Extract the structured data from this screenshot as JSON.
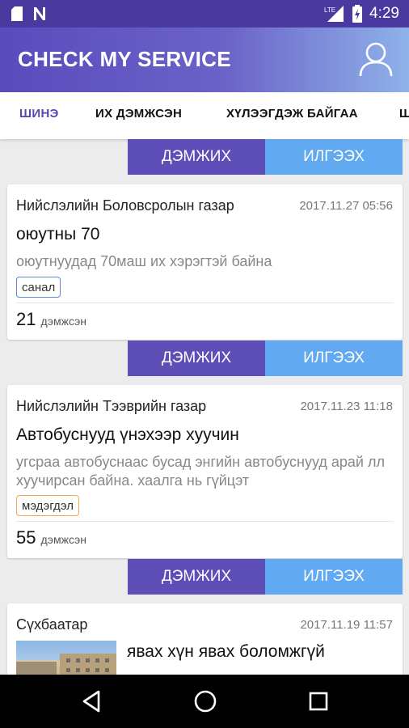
{
  "status_bar": {
    "time": "4:29",
    "network": "LTE"
  },
  "app": {
    "title": "CHECK MY SERVICE",
    "user_icon": "user-icon"
  },
  "tabs": [
    {
      "label": "ШИНЭ",
      "active": true
    },
    {
      "label": "ИХ ДЭМЖСЭН",
      "active": false
    },
    {
      "label": "ХҮЛЭЭГДЭЖ БАЙГАА",
      "active": false
    },
    {
      "label": "Ш",
      "active": false
    }
  ],
  "actions": {
    "support_label": "ДЭМЖИХ",
    "send_label": "ИЛГЭЭХ"
  },
  "posts": [
    {
      "org": "Нийслэлийн Боловсролын газар",
      "date": "2017.11.27 05:56",
      "title": "оюутны 70",
      "description": "оюутнуудад 70маш их хэрэгтэй байна",
      "tag": "санал",
      "tag_color": "#5b8bd6",
      "count": "21",
      "count_label": "дэмжсэн"
    },
    {
      "org": "Нийслэлийн Тээврийн газар",
      "date": "2017.11.23 11:18",
      "title": "Автобуснууд үнэхээр хуучин",
      "description": "угсраа автобуснаас бусад энгийн автобуснууд арай лл хуучирсан байна. хаалга нь гүйцэт",
      "tag": "мэдэгдэл",
      "tag_color": "#f3a656",
      "count": "55",
      "count_label": "дэмжсэн"
    },
    {
      "org": "Сүхбаатар",
      "date": "2017.11.19 11:57",
      "title": "явах хүн явах боломжгүй"
    }
  ],
  "colors": {
    "primary": "#5e4eb8",
    "accent": "#61a9f0"
  }
}
